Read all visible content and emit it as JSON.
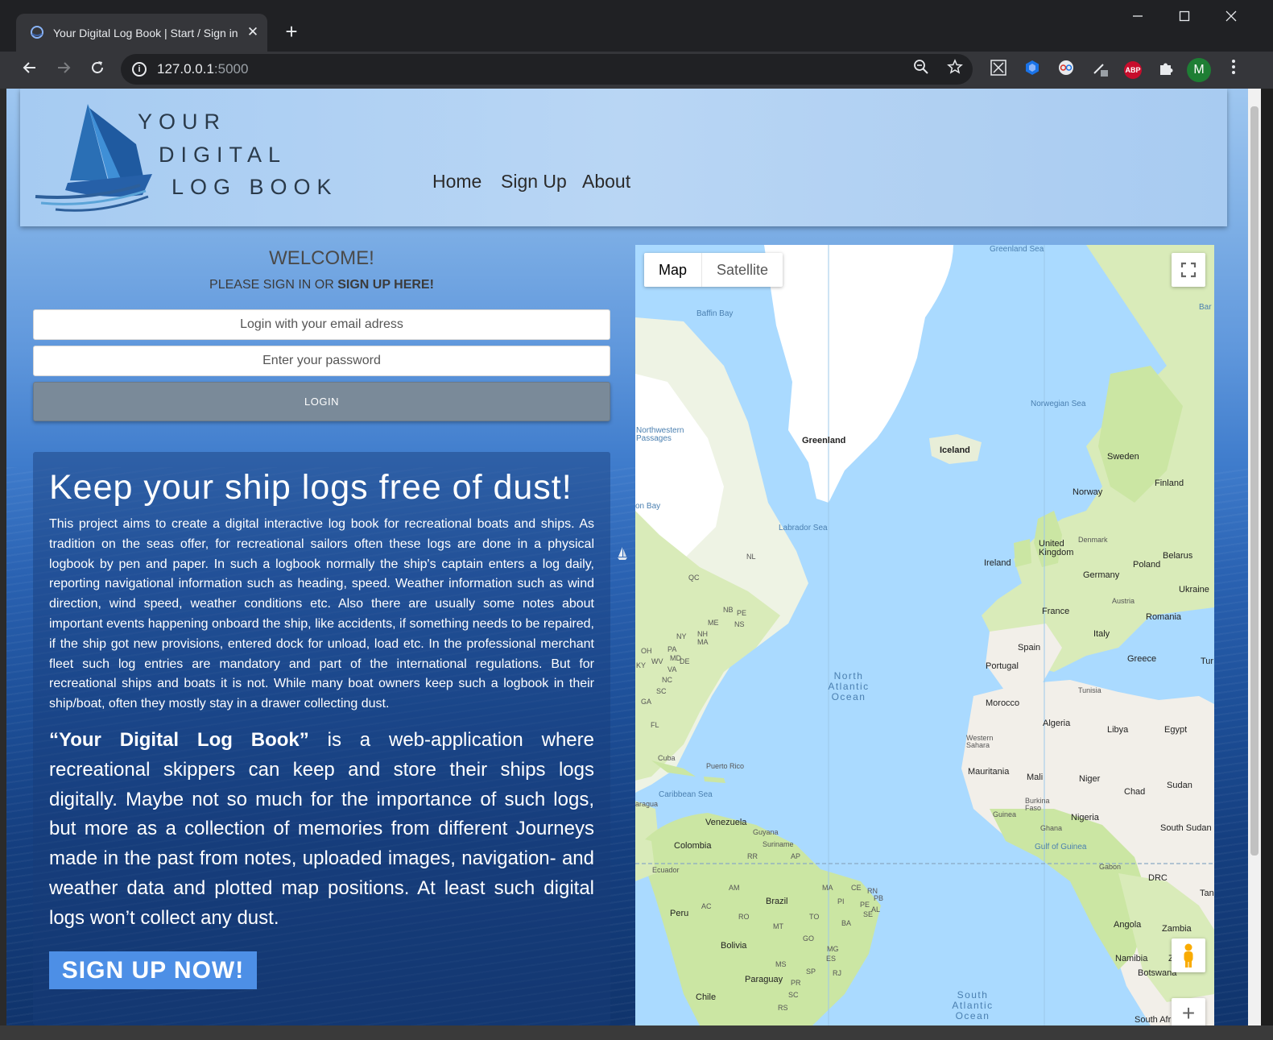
{
  "browser": {
    "tab_title": "Your Digital Log Book | Start / Sign in",
    "tab_close": "✕",
    "new_tab": "+",
    "url_host": "127.0.0.1",
    "url_port": ":5000",
    "profile_initial": "M",
    "abp_label": "ABP"
  },
  "header": {
    "logo_line1": "YOUR",
    "logo_line2": "DIGITAL",
    "logo_line3": "LOG BOOK",
    "nav": [
      "Home",
      "Sign Up",
      "About"
    ]
  },
  "login": {
    "welcome": "WELCOME!",
    "prompt_prefix": "PLEASE SIGN IN OR ",
    "prompt_link": "SIGN UP HERE!",
    "email_placeholder": "Login with your email adress",
    "password_placeholder": "Enter your password",
    "login_button": "LOGIN"
  },
  "info": {
    "title": "Keep your ship logs free of dust!",
    "paragraph1": "This project aims to create a digital interactive log book for recreational boats and ships. As tradition on the seas offer, for recreational sailors often these logs are done in a physical logbook by pen and paper. In such a logbook normally the ship's captain enters a log daily, reporting navigational information such as heading, speed. Weather information such as wind direction, wind speed, weather conditions etc. Also there are usually some notes about important events happening onboard the ship, like accidents, if something needs to be repaired, if the ship got new provisions, entered dock for unload, load etc. In the professional merchant fleet such log entries are mandatory and part of the international regulations. But for recreational ships and boats it is not. While many boat owners keep such a logbook in their ship/boat, often they mostly stay in a drawer collecting dust.",
    "paragraph2_bold": "“Your Digital Log Book”",
    "paragraph2_rest": " is a web-application where recreational skippers can keep and store their ships logs digitally. Maybe not so much for the importance of such logs, but more as a collection of memories from different Journeys made in the past from notes, uploaded images, navigation- and weather data and plotted map positions. At least such digital logs won’t collect any dust.",
    "signup_button": "SIGN UP NOW!"
  },
  "map": {
    "type_map": "Map",
    "type_satellite": "Satellite",
    "zoom_in": "+",
    "labels": {
      "greenland_sea": "Greenland Sea",
      "baffin_bay": "Baffin Bay",
      "bar": "Bar",
      "greenland": "Greenland",
      "iceland": "Iceland",
      "norwegian_sea": "Norwegian Sea",
      "northwestern_passages": "Northwestern Passages",
      "sweden": "Sweden",
      "finland": "Finland",
      "norway": "Norway",
      "on_bay": "on Bay",
      "labrador_sea": "Labrador Sea",
      "denmark": "Denmark",
      "united_kingdom": "United Kingdom",
      "ireland": "Ireland",
      "belarus": "Belarus",
      "poland": "Poland",
      "nl": "NL",
      "germany": "Germany",
      "ukraine": "Ukraine",
      "qc": "QC",
      "austria": "Austria",
      "france": "France",
      "romania": "Romania",
      "nb": "NB",
      "pe": "PE",
      "ns": "NS",
      "me": "ME",
      "ny": "NY",
      "nh": "NH",
      "ma": "MA",
      "italy": "Italy",
      "spain": "Spain",
      "oh": "OH",
      "pa": "PA",
      "md": "MD",
      "de": "DE",
      "wv": "WV",
      "va": "VA",
      "ky": "KY",
      "nc": "NC",
      "sc": "SC",
      "ga": "GA",
      "portugal": "Portugal",
      "greece": "Greece",
      "tur": "Tur",
      "north_atlantic_ocean": "North Atlantic Ocean",
      "tunisia": "Tunisia",
      "morocco": "Morocco",
      "fl": "FL",
      "algeria": "Algeria",
      "libya": "Libya",
      "egypt": "Egypt",
      "western_sahara": "Western Sahara",
      "cuba": "Cuba",
      "puerto_rico": "Puerto Rico",
      "mauritania": "Mauritania",
      "mali": "Mali",
      "niger": "Niger",
      "sudan": "Sudan",
      "chad": "Chad",
      "caribbean_sea": "Caribbean Sea",
      "aragua": "aragua",
      "burkina_faso": "Burkina Faso",
      "guinea": "Guinea",
      "nigeria": "Nigeria",
      "venezuela": "Venezuela",
      "ghana": "Ghana",
      "guyana": "Guyana",
      "south_sudan": "South Sudan",
      "colombia": "Colombia",
      "suriname": "Suriname",
      "gulf_of_guinea": "Gulf of Guinea",
      "rr": "RR",
      "ap": "AP",
      "ecuador": "Ecuador",
      "gabon": "Gabon",
      "drc": "DRC",
      "am": "AM",
      "ma2": "MA",
      "ce": "CE",
      "rn": "RN",
      "pb": "PB",
      "tanz": "Tanz",
      "brazil": "Brazil",
      "pi": "PI",
      "peru": "Peru",
      "ac": "AC",
      "ro": "RO",
      "to": "TO",
      "ba": "BA",
      "se": "SE",
      "al": "AL",
      "pe2": "PE",
      "angola": "Angola",
      "zambia": "Zambia",
      "mt": "MT",
      "bolivia": "Bolivia",
      "go": "GO",
      "mg": "MG",
      "namibia": "Namibia",
      "z": "Z",
      "ms": "MS",
      "es": "ES",
      "botswana": "Botswana",
      "paraguay": "Paraguay",
      "sp": "SP",
      "rj": "RJ",
      "pr": "PR",
      "chile": "Chile",
      "sc2": "SC",
      "south_atlantic_ocean": "South Atlantic Ocean",
      "rs": "RS",
      "south_afr": "South Afr"
    }
  },
  "colors": {
    "header_bg": "#b9d6f4",
    "login_button": "#7a8a99",
    "signup_button": "#4d8fe6",
    "water": "#aadaff",
    "land": "#f2efe9",
    "vegetation": "#cbe6a3",
    "ice": "#ffffff",
    "browser_dark": "#202124"
  }
}
